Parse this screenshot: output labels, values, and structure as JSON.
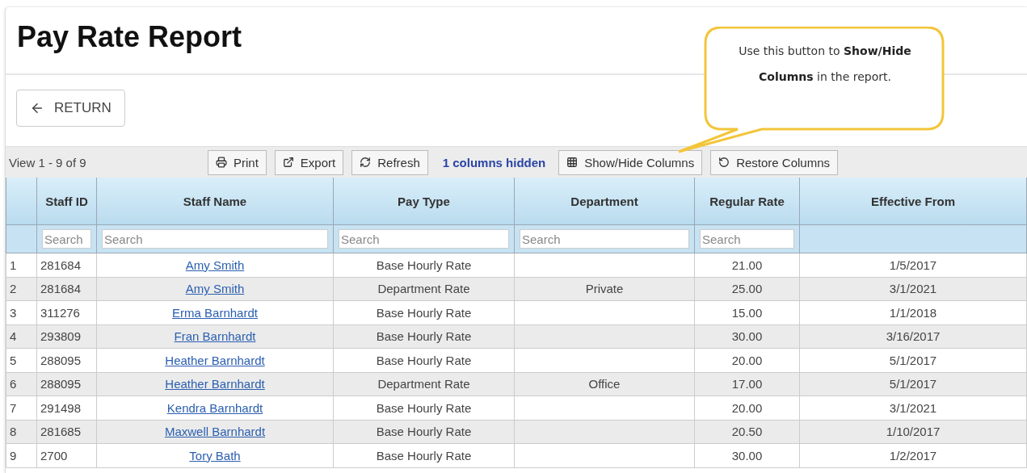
{
  "page": {
    "title": "Pay Rate Report"
  },
  "return_button": {
    "label": "RETURN"
  },
  "toolbar": {
    "view_info": "View 1 - 9 of 9",
    "buttons": [
      {
        "kind": "print",
        "label": "Print"
      },
      {
        "kind": "export",
        "label": "Export"
      },
      {
        "kind": "refresh",
        "label": "Refresh"
      }
    ],
    "hidden_info": "1 columns hidden",
    "column_buttons": [
      {
        "kind": "grid",
        "label": "Show/Hide Columns"
      },
      {
        "kind": "restore",
        "label": "Restore Columns"
      }
    ]
  },
  "callout": {
    "text": "Use this button to **Show/Hide Columns** in the report."
  },
  "table": {
    "columns": [
      {
        "label": "Staff ID",
        "placeholder": "Search"
      },
      {
        "label": "Staff Name",
        "placeholder": "Search"
      },
      {
        "label": "Pay Type",
        "placeholder": "Search"
      },
      {
        "label": "Department",
        "placeholder": "Search"
      },
      {
        "label": "Regular Rate",
        "placeholder": "Search"
      },
      {
        "label": "Effective From"
      }
    ],
    "rows": [
      {
        "num": "1",
        "id": "281684",
        "name": "Amy Smith",
        "pay_type": "Base Hourly Rate",
        "department": "",
        "rate": "21.00",
        "effective": "1/5/2017"
      },
      {
        "num": "2",
        "id": "281684",
        "name": "Amy Smith",
        "pay_type": "Department Rate",
        "department": "Private",
        "rate": "25.00",
        "effective": "3/1/2021"
      },
      {
        "num": "3",
        "id": "311276",
        "name": "Erma Barnhardt",
        "pay_type": "Base Hourly Rate",
        "department": "",
        "rate": "15.00",
        "effective": "1/1/2018"
      },
      {
        "num": "4",
        "id": "293809",
        "name": "Fran Barnhardt",
        "pay_type": "Base Hourly Rate",
        "department": "",
        "rate": "30.00",
        "effective": "3/16/2017"
      },
      {
        "num": "5",
        "id": "288095",
        "name": "Heather Barnhardt",
        "pay_type": "Base Hourly Rate",
        "department": "",
        "rate": "20.00",
        "effective": "5/1/2017"
      },
      {
        "num": "6",
        "id": "288095",
        "name": "Heather Barnhardt",
        "pay_type": "Department Rate",
        "department": "Office",
        "rate": "17.00",
        "effective": "5/1/2017"
      },
      {
        "num": "7",
        "id": "291498",
        "name": "Kendra Barnhardt",
        "pay_type": "Base Hourly Rate",
        "department": "",
        "rate": "20.00",
        "effective": "3/1/2021"
      },
      {
        "num": "8",
        "id": "281685",
        "name": "Maxwell Barnhardt",
        "pay_type": "Base Hourly Rate",
        "department": "",
        "rate": "20.50",
        "effective": "1/10/2017"
      },
      {
        "num": "9",
        "id": "2700",
        "name": "Tory Bath",
        "pay_type": "Base Hourly Rate",
        "department": "",
        "rate": "30.00",
        "effective": "1/2/2017"
      }
    ]
  }
}
